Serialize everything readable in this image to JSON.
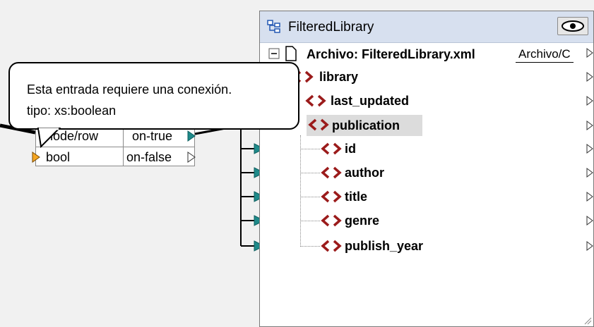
{
  "component": {
    "title": "FilteredLibrary",
    "file_label": "Archivo: FilteredLibrary.xml",
    "file_button": "Archivo/C",
    "items": [
      {
        "name": "library"
      },
      {
        "name": "last_updated"
      },
      {
        "name": "publication"
      },
      {
        "name": "id"
      },
      {
        "name": "author"
      },
      {
        "name": "title"
      },
      {
        "name": "genre"
      },
      {
        "name": "publish_year"
      }
    ]
  },
  "filter": {
    "row1_left": "node/row",
    "row1_right": "on-true",
    "row2_left": "bool",
    "row2_right": "on-false"
  },
  "tooltip": {
    "line1": "Esta entrada requiere una conexión.",
    "line2": "tipo: xs:boolean"
  },
  "colors": {
    "element_icon": "#9b1b1b",
    "input_connector": "#1f8a8a",
    "header_bg": "#d7e0ef"
  }
}
